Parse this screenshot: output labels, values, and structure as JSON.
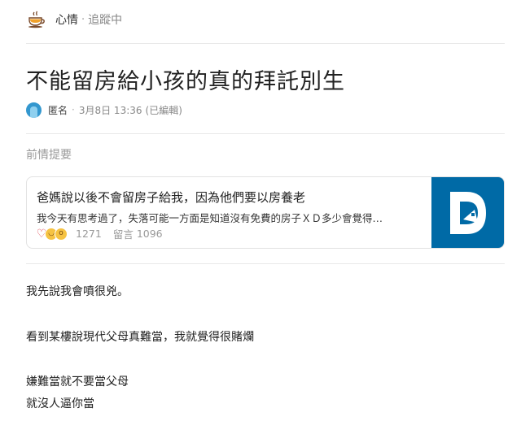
{
  "forum": {
    "name": "心情",
    "follow_status": "追蹤中",
    "icon": "coffee-cup-icon"
  },
  "post": {
    "title": "不能留房給小孩的真的拜託別生",
    "author": "匿名",
    "date": "3月8日 13:36",
    "edited": "(已編輯)",
    "avatar_color": "#3397cf"
  },
  "previous": {
    "label": "前情提要",
    "card": {
      "title": "爸媽說以後不會留房子給我，因為他們要以房養老",
      "excerpt": "我今天有思考過了，失落可能一方面是知道沒有免費的房子ＸＤ多少會覺得…",
      "likes": "1271",
      "comments_label": "留言",
      "comments": "1096",
      "reactions": [
        "heart",
        "laugh",
        "wow"
      ],
      "thumb_color": "#006aa6"
    }
  },
  "body": {
    "lines": [
      "我先說我會噴很兇。",
      "看到某樓說現代父母真難當，我就覺得很賭爛",
      "嫌難當就不要當父母",
      "就沒人逼你當"
    ]
  }
}
